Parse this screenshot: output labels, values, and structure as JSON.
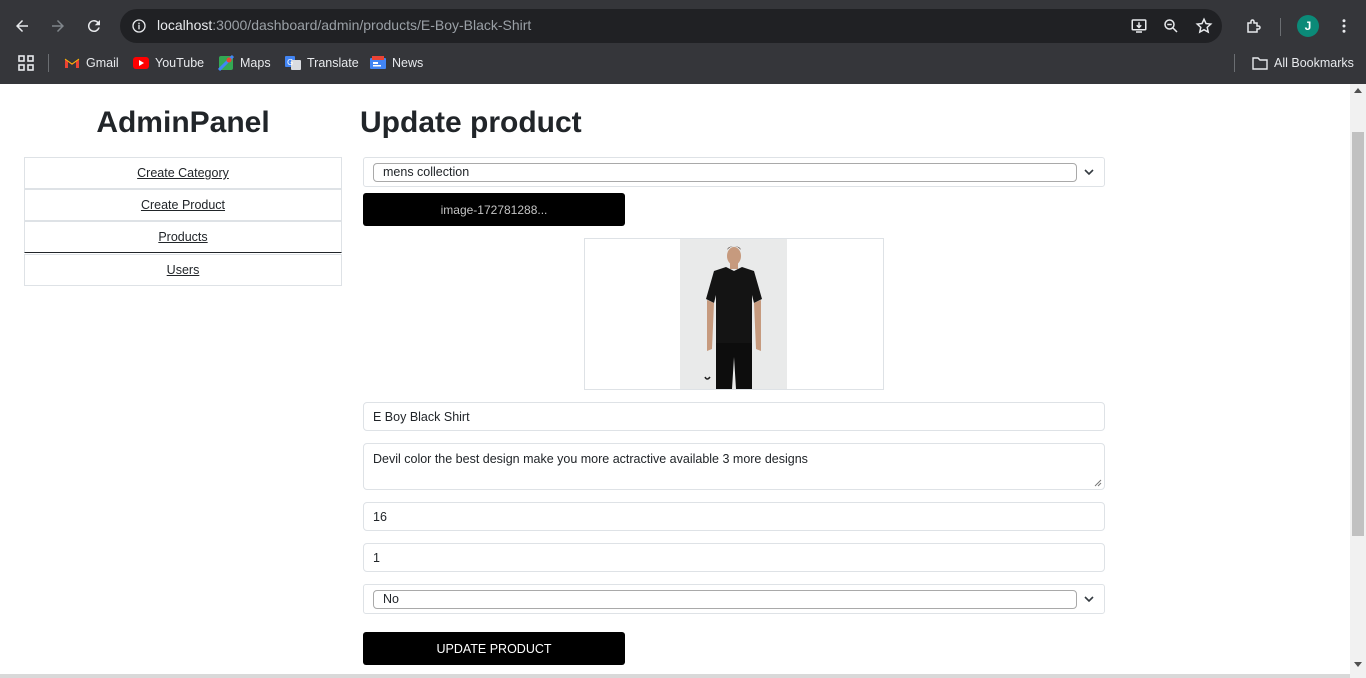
{
  "browser": {
    "url_host": "localhost",
    "url_path": ":3000/dashboard/admin/products/E-Boy-Black-Shirt",
    "profile_initial": "J",
    "bookmarks": [
      {
        "label": "Gmail",
        "icon": "gmail-icon"
      },
      {
        "label": "YouTube",
        "icon": "youtube-icon"
      },
      {
        "label": "Maps",
        "icon": "maps-icon"
      },
      {
        "label": "Translate",
        "icon": "translate-icon"
      },
      {
        "label": "News",
        "icon": "news-icon"
      }
    ],
    "all_bookmarks_label": "All Bookmarks"
  },
  "sidebar": {
    "title": "AdminPanel",
    "items": [
      {
        "label": "Create Category"
      },
      {
        "label": "Create Product"
      },
      {
        "label": "Products"
      },
      {
        "label": "Users"
      }
    ]
  },
  "form": {
    "title": "Update product",
    "category_selected": "mens collection",
    "upload_label": "image-172781288...",
    "name_value": "E Boy Black Shirt",
    "description_value": "Devil color the best design make you more actractive available 3 more designs",
    "price_value": "16",
    "quantity_value": "1",
    "shipping_selected": "No",
    "submit_label": "UPDATE PRODUCT"
  },
  "colors": {
    "chrome_bg": "#35363a",
    "omnibox_bg": "#202124",
    "button_bg": "#000000",
    "avatar_bg": "#0b8a78"
  }
}
